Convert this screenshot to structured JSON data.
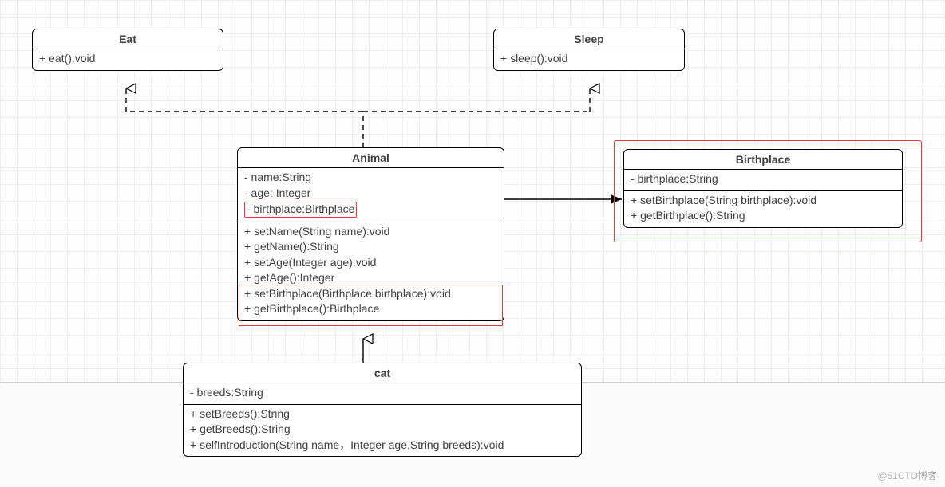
{
  "interfaces": {
    "eat": {
      "name": "Eat",
      "method": "+ eat():void"
    },
    "sleep": {
      "name": "Sleep",
      "method": "+ sleep():void"
    }
  },
  "animal": {
    "name": "Animal",
    "attrs": {
      "a0": "- name:String",
      "a1": "- age: Integer",
      "a2": "- birthplace:Birthplace"
    },
    "methods": {
      "m0": "+ setName(String name):void",
      "m1": "+ getName():String",
      "m2": "+ setAge(Integer age):void",
      "m3": "+ getAge():Integer",
      "m4": "+ setBirthplace(Birthplace birthplace):void",
      "m5": "+ getBirthplace():Birthplace"
    }
  },
  "birthplace": {
    "name": "Birthplace",
    "attrs": {
      "a0": "- birthplace:String"
    },
    "methods": {
      "m0": "+ setBirthplace(String birthplace):void",
      "m1": "+ getBirthplace():String"
    }
  },
  "cat": {
    "name": "cat",
    "attrs": {
      "a0": "- breeds:String"
    },
    "methods": {
      "m0": "+ setBreeds():String",
      "m1": "+ getBreeds():String",
      "m2": "+ selfIntroduction(String name，Integer age,String breeds):void"
    }
  },
  "watermark": "@51CTO博客"
}
